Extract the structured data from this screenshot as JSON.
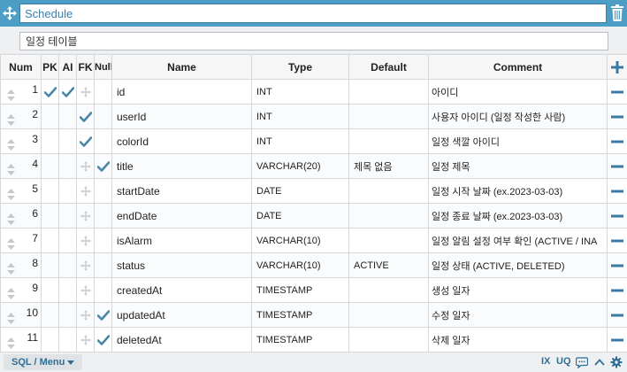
{
  "table_name": "Schedule",
  "table_comment": "일정 테이블",
  "columns": {
    "num": "Num",
    "pk": "PK",
    "ai": "AI",
    "fk": "FK",
    "null": "Null",
    "name": "Name",
    "type": "Type",
    "default": "Default",
    "comment": "Comment"
  },
  "rows": [
    {
      "num": "1",
      "pk": true,
      "ai": true,
      "fk_handle": true,
      "fk": false,
      "null": false,
      "name": "id",
      "type": "INT",
      "default": "",
      "comment": "아이디"
    },
    {
      "num": "2",
      "pk": false,
      "ai": false,
      "fk_handle": false,
      "fk": true,
      "null": false,
      "name": "userId",
      "type": "INT",
      "default": "",
      "comment": "사용자 아이디 (일정 작성한 사람)"
    },
    {
      "num": "3",
      "pk": false,
      "ai": false,
      "fk_handle": false,
      "fk": true,
      "null": false,
      "name": "colorId",
      "type": "INT",
      "default": "",
      "comment": "일정 색깔 아이디"
    },
    {
      "num": "4",
      "pk": false,
      "ai": false,
      "fk_handle": true,
      "fk": false,
      "null": true,
      "name": "title",
      "type": "VARCHAR(20)",
      "default": "제목 없음",
      "comment": "일정 제목"
    },
    {
      "num": "5",
      "pk": false,
      "ai": false,
      "fk_handle": true,
      "fk": false,
      "null": false,
      "name": "startDate",
      "type": "DATE",
      "default": "",
      "comment": "일정 시작 날짜 (ex.2023-03-03)"
    },
    {
      "num": "6",
      "pk": false,
      "ai": false,
      "fk_handle": true,
      "fk": false,
      "null": false,
      "name": "endDate",
      "type": "DATE",
      "default": "",
      "comment": "일정 종료 날짜 (ex.2023-03-03)"
    },
    {
      "num": "7",
      "pk": false,
      "ai": false,
      "fk_handle": true,
      "fk": false,
      "null": false,
      "name": "isAlarm",
      "type": "VARCHAR(10)",
      "default": "",
      "comment": "일정 알림 설정 여부 확인 (ACTIVE / INA"
    },
    {
      "num": "8",
      "pk": false,
      "ai": false,
      "fk_handle": true,
      "fk": false,
      "null": false,
      "name": "status",
      "type": "VARCHAR(10)",
      "default": "ACTIVE",
      "comment": "일정 상태 (ACTIVE, DELETED)"
    },
    {
      "num": "9",
      "pk": false,
      "ai": false,
      "fk_handle": true,
      "fk": false,
      "null": false,
      "name": "createdAt",
      "type": "TIMESTAMP",
      "default": "",
      "comment": "생성 일자"
    },
    {
      "num": "10",
      "pk": false,
      "ai": false,
      "fk_handle": true,
      "fk": false,
      "null": true,
      "name": "updatedAt",
      "type": "TIMESTAMP",
      "default": "",
      "comment": "수정 일자"
    },
    {
      "num": "11",
      "pk": false,
      "ai": false,
      "fk_handle": true,
      "fk": false,
      "null": true,
      "name": "deletedAt",
      "type": "TIMESTAMP",
      "default": "",
      "comment": "삭제 일자"
    }
  ],
  "footer": {
    "sql_menu": "SQL / Menu",
    "ix": "IX",
    "uq": "UQ"
  },
  "icons": {
    "move": "move-icon",
    "trash": "trash-icon",
    "add_column": "plus-icon",
    "remove_row": "minus-icon",
    "sort_handle": "sort-icon",
    "check": "check-icon",
    "fk_handle": "fk-drag-icon",
    "comment": "speech-bubble-icon",
    "collapse": "chevron-up-icon",
    "settings": "gear-icon"
  },
  "colors": {
    "header_bar": "#4d9ec6",
    "check": "#4a86a8",
    "accent_text": "#2f6f95",
    "action": "#3b7aa3"
  }
}
